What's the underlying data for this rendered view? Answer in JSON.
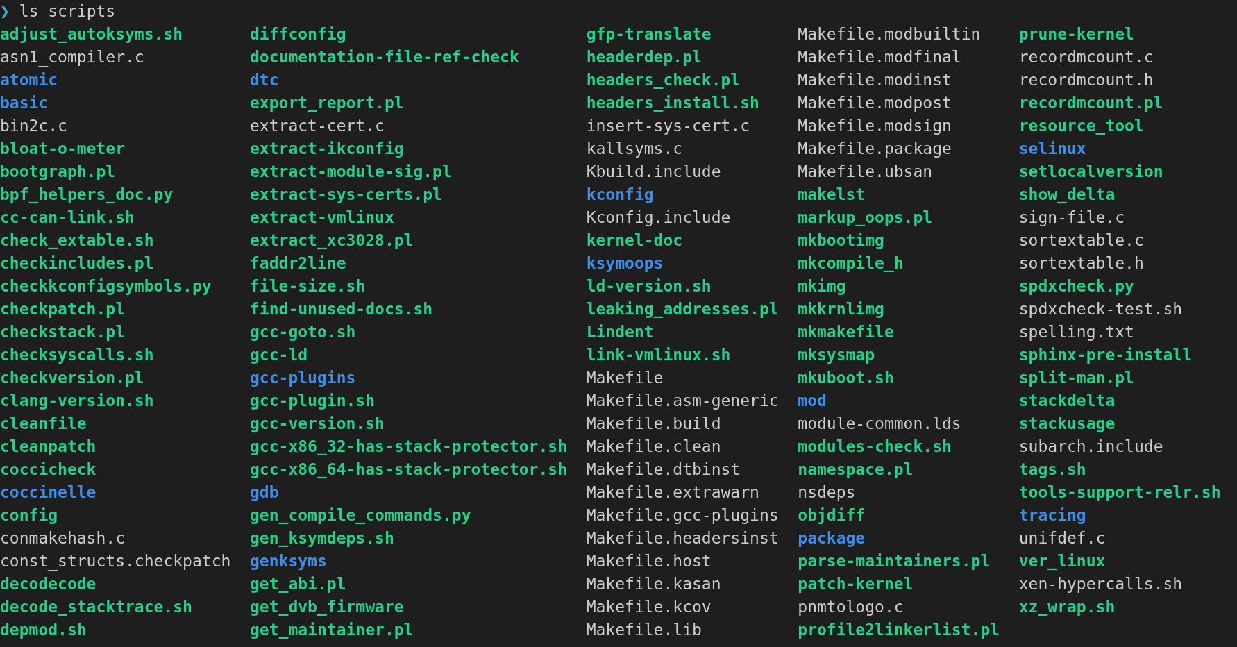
{
  "prompt": {
    "symbol": "❯",
    "command": "ls scripts"
  },
  "columns": [
    [
      {
        "name": "adjust_autoksyms.sh",
        "kind": "exec"
      },
      {
        "name": "asn1_compiler.c",
        "kind": "file"
      },
      {
        "name": "atomic",
        "kind": "dir"
      },
      {
        "name": "basic",
        "kind": "dir"
      },
      {
        "name": "bin2c.c",
        "kind": "file"
      },
      {
        "name": "bloat-o-meter",
        "kind": "exec"
      },
      {
        "name": "bootgraph.pl",
        "kind": "exec"
      },
      {
        "name": "bpf_helpers_doc.py",
        "kind": "exec"
      },
      {
        "name": "cc-can-link.sh",
        "kind": "exec"
      },
      {
        "name": "check_extable.sh",
        "kind": "exec"
      },
      {
        "name": "checkincludes.pl",
        "kind": "exec"
      },
      {
        "name": "checkkconfigsymbols.py",
        "kind": "exec"
      },
      {
        "name": "checkpatch.pl",
        "kind": "exec"
      },
      {
        "name": "checkstack.pl",
        "kind": "exec"
      },
      {
        "name": "checksyscalls.sh",
        "kind": "exec"
      },
      {
        "name": "checkversion.pl",
        "kind": "exec"
      },
      {
        "name": "clang-version.sh",
        "kind": "exec"
      },
      {
        "name": "cleanfile",
        "kind": "exec"
      },
      {
        "name": "cleanpatch",
        "kind": "exec"
      },
      {
        "name": "coccicheck",
        "kind": "exec"
      },
      {
        "name": "coccinelle",
        "kind": "dir"
      },
      {
        "name": "config",
        "kind": "exec"
      },
      {
        "name": "conmakehash.c",
        "kind": "file"
      },
      {
        "name": "const_structs.checkpatch",
        "kind": "file"
      },
      {
        "name": "decodecode",
        "kind": "exec"
      },
      {
        "name": "decode_stacktrace.sh",
        "kind": "exec"
      },
      {
        "name": "depmod.sh",
        "kind": "exec"
      }
    ],
    [
      {
        "name": "diffconfig",
        "kind": "exec"
      },
      {
        "name": "documentation-file-ref-check",
        "kind": "exec"
      },
      {
        "name": "dtc",
        "kind": "dir"
      },
      {
        "name": "export_report.pl",
        "kind": "exec"
      },
      {
        "name": "extract-cert.c",
        "kind": "file"
      },
      {
        "name": "extract-ikconfig",
        "kind": "exec"
      },
      {
        "name": "extract-module-sig.pl",
        "kind": "exec"
      },
      {
        "name": "extract-sys-certs.pl",
        "kind": "exec"
      },
      {
        "name": "extract-vmlinux",
        "kind": "exec"
      },
      {
        "name": "extract_xc3028.pl",
        "kind": "exec"
      },
      {
        "name": "faddr2line",
        "kind": "exec"
      },
      {
        "name": "file-size.sh",
        "kind": "exec"
      },
      {
        "name": "find-unused-docs.sh",
        "kind": "exec"
      },
      {
        "name": "gcc-goto.sh",
        "kind": "exec"
      },
      {
        "name": "gcc-ld",
        "kind": "exec"
      },
      {
        "name": "gcc-plugins",
        "kind": "dir"
      },
      {
        "name": "gcc-plugin.sh",
        "kind": "exec"
      },
      {
        "name": "gcc-version.sh",
        "kind": "exec"
      },
      {
        "name": "gcc-x86_32-has-stack-protector.sh",
        "kind": "exec"
      },
      {
        "name": "gcc-x86_64-has-stack-protector.sh",
        "kind": "exec"
      },
      {
        "name": "gdb",
        "kind": "dir"
      },
      {
        "name": "gen_compile_commands.py",
        "kind": "exec"
      },
      {
        "name": "gen_ksymdeps.sh",
        "kind": "exec"
      },
      {
        "name": "genksyms",
        "kind": "dir"
      },
      {
        "name": "get_abi.pl",
        "kind": "exec"
      },
      {
        "name": "get_dvb_firmware",
        "kind": "exec"
      },
      {
        "name": "get_maintainer.pl",
        "kind": "exec"
      }
    ],
    [
      {
        "name": "gfp-translate",
        "kind": "exec"
      },
      {
        "name": "headerdep.pl",
        "kind": "exec"
      },
      {
        "name": "headers_check.pl",
        "kind": "exec"
      },
      {
        "name": "headers_install.sh",
        "kind": "exec"
      },
      {
        "name": "insert-sys-cert.c",
        "kind": "file"
      },
      {
        "name": "kallsyms.c",
        "kind": "file"
      },
      {
        "name": "Kbuild.include",
        "kind": "file"
      },
      {
        "name": "kconfig",
        "kind": "dir"
      },
      {
        "name": "Kconfig.include",
        "kind": "file"
      },
      {
        "name": "kernel-doc",
        "kind": "exec"
      },
      {
        "name": "ksymoops",
        "kind": "dir"
      },
      {
        "name": "ld-version.sh",
        "kind": "exec"
      },
      {
        "name": "leaking_addresses.pl",
        "kind": "exec"
      },
      {
        "name": "Lindent",
        "kind": "exec"
      },
      {
        "name": "link-vmlinux.sh",
        "kind": "exec"
      },
      {
        "name": "Makefile",
        "kind": "file"
      },
      {
        "name": "Makefile.asm-generic",
        "kind": "file"
      },
      {
        "name": "Makefile.build",
        "kind": "file"
      },
      {
        "name": "Makefile.clean",
        "kind": "file"
      },
      {
        "name": "Makefile.dtbinst",
        "kind": "file"
      },
      {
        "name": "Makefile.extrawarn",
        "kind": "file"
      },
      {
        "name": "Makefile.gcc-plugins",
        "kind": "file"
      },
      {
        "name": "Makefile.headersinst",
        "kind": "file"
      },
      {
        "name": "Makefile.host",
        "kind": "file"
      },
      {
        "name": "Makefile.kasan",
        "kind": "file"
      },
      {
        "name": "Makefile.kcov",
        "kind": "file"
      },
      {
        "name": "Makefile.lib",
        "kind": "file"
      }
    ],
    [
      {
        "name": "Makefile.modbuiltin",
        "kind": "file"
      },
      {
        "name": "Makefile.modfinal",
        "kind": "file"
      },
      {
        "name": "Makefile.modinst",
        "kind": "file"
      },
      {
        "name": "Makefile.modpost",
        "kind": "file"
      },
      {
        "name": "Makefile.modsign",
        "kind": "file"
      },
      {
        "name": "Makefile.package",
        "kind": "file"
      },
      {
        "name": "Makefile.ubsan",
        "kind": "file"
      },
      {
        "name": "makelst",
        "kind": "exec"
      },
      {
        "name": "markup_oops.pl",
        "kind": "exec"
      },
      {
        "name": "mkbootimg",
        "kind": "exec"
      },
      {
        "name": "mkcompile_h",
        "kind": "exec"
      },
      {
        "name": "mkimg",
        "kind": "exec"
      },
      {
        "name": "mkkrnlimg",
        "kind": "exec"
      },
      {
        "name": "mkmakefile",
        "kind": "exec"
      },
      {
        "name": "mksysmap",
        "kind": "exec"
      },
      {
        "name": "mkuboot.sh",
        "kind": "exec"
      },
      {
        "name": "mod",
        "kind": "dir"
      },
      {
        "name": "module-common.lds",
        "kind": "file"
      },
      {
        "name": "modules-check.sh",
        "kind": "exec"
      },
      {
        "name": "namespace.pl",
        "kind": "exec"
      },
      {
        "name": "nsdeps",
        "kind": "file"
      },
      {
        "name": "objdiff",
        "kind": "exec"
      },
      {
        "name": "package",
        "kind": "dir"
      },
      {
        "name": "parse-maintainers.pl",
        "kind": "exec"
      },
      {
        "name": "patch-kernel",
        "kind": "exec"
      },
      {
        "name": "pnmtologo.c",
        "kind": "file"
      },
      {
        "name": "profile2linkerlist.pl",
        "kind": "exec"
      }
    ],
    [
      {
        "name": "prune-kernel",
        "kind": "exec"
      },
      {
        "name": "recordmcount.c",
        "kind": "file"
      },
      {
        "name": "recordmcount.h",
        "kind": "file"
      },
      {
        "name": "recordmcount.pl",
        "kind": "exec"
      },
      {
        "name": "resource_tool",
        "kind": "exec"
      },
      {
        "name": "selinux",
        "kind": "dir"
      },
      {
        "name": "setlocalversion",
        "kind": "exec"
      },
      {
        "name": "show_delta",
        "kind": "exec"
      },
      {
        "name": "sign-file.c",
        "kind": "file"
      },
      {
        "name": "sortextable.c",
        "kind": "file"
      },
      {
        "name": "sortextable.h",
        "kind": "file"
      },
      {
        "name": "spdxcheck.py",
        "kind": "exec"
      },
      {
        "name": "spdxcheck-test.sh",
        "kind": "file"
      },
      {
        "name": "spelling.txt",
        "kind": "file"
      },
      {
        "name": "sphinx-pre-install",
        "kind": "exec"
      },
      {
        "name": "split-man.pl",
        "kind": "exec"
      },
      {
        "name": "stackdelta",
        "kind": "exec"
      },
      {
        "name": "stackusage",
        "kind": "exec"
      },
      {
        "name": "subarch.include",
        "kind": "file"
      },
      {
        "name": "tags.sh",
        "kind": "exec"
      },
      {
        "name": "tools-support-relr.sh",
        "kind": "exec"
      },
      {
        "name": "tracing",
        "kind": "dir"
      },
      {
        "name": "unifdef.c",
        "kind": "file"
      },
      {
        "name": "ver_linux",
        "kind": "exec"
      },
      {
        "name": "xen-hypercalls.sh",
        "kind": "file"
      },
      {
        "name": "xz_wrap.sh",
        "kind": "exec"
      }
    ]
  ]
}
